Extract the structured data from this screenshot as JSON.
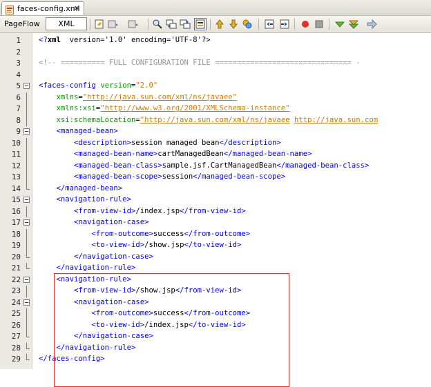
{
  "tab": {
    "title": "faces-config.xml",
    "close": "×",
    "icon": "xml-file-icon"
  },
  "toolbar": {
    "pageflow_label": "PageFlow",
    "xml_label": "XML",
    "icons": [
      "last-edit-icon",
      "back-icon",
      "forward-icon",
      "find-selection-icon",
      "find-previous-icon",
      "find-next-icon",
      "toggle-highlight-icon",
      "previous-bookmark-icon",
      "next-bookmark-icon",
      "toggle-bookmark-icon",
      "shift-left-icon",
      "shift-right-icon",
      "start-macro-icon",
      "stop-macro-icon",
      "check-xml-icon",
      "validate-xml-icon",
      "xsl-transform-icon"
    ]
  },
  "editor": {
    "lines": [
      {
        "n": "1",
        "parts": [
          [
            "t",
            "<?"
          ],
          [
            "b",
            "xml"
          ],
          [
            "",
            "  version='1.0' encoding='UTF-8'?>"
          ]
        ]
      },
      {
        "n": "2",
        "parts": []
      },
      {
        "n": "3",
        "parts": [
          [
            "c",
            "<!-- ========== FULL CONFIGURATION FILE =============================== -"
          ]
        ]
      },
      {
        "n": "4",
        "parts": []
      },
      {
        "n": "5",
        "fold": "open",
        "parts": [
          [
            "t",
            "<faces-config"
          ],
          [
            "",
            " "
          ],
          [
            "a",
            "version"
          ],
          [
            "",
            "="
          ],
          [
            "s",
            "\"2.0\""
          ]
        ]
      },
      {
        "n": "6",
        "fold": "line",
        "parts": [
          [
            "",
            "    "
          ],
          [
            "a",
            "xmlns"
          ],
          [
            "",
            "="
          ],
          [
            "v",
            "\"http://java.sun.com/xml/ns/javaee\""
          ]
        ]
      },
      {
        "n": "7",
        "fold": "line",
        "parts": [
          [
            "",
            "    "
          ],
          [
            "a",
            "xmlns:xsi"
          ],
          [
            "",
            "="
          ],
          [
            "v",
            "\"http://www.w3.org/2001/XMLSchema-instance\""
          ]
        ]
      },
      {
        "n": "8",
        "fold": "line",
        "parts": [
          [
            "",
            "    "
          ],
          [
            "a",
            "xsi:schemaLocation"
          ],
          [
            "",
            "="
          ],
          [
            "v",
            "\"http://java.sun.com/xml/ns/javaee"
          ],
          [
            "",
            " "
          ],
          [
            "v",
            "http://java.sun.com"
          ]
        ]
      },
      {
        "n": "9",
        "fold": "open",
        "parts": [
          [
            "",
            "    "
          ],
          [
            "t",
            "<managed-bean>"
          ]
        ]
      },
      {
        "n": "10",
        "fold": "line",
        "parts": [
          [
            "",
            "        "
          ],
          [
            "t",
            "<description>"
          ],
          [
            "",
            "session managed bean"
          ],
          [
            "t",
            "</description>"
          ]
        ]
      },
      {
        "n": "11",
        "fold": "line",
        "parts": [
          [
            "",
            "        "
          ],
          [
            "t",
            "<managed-bean-name>"
          ],
          [
            "",
            "cartManagedBean"
          ],
          [
            "t",
            "</managed-bean-name>"
          ]
        ]
      },
      {
        "n": "12",
        "fold": "line",
        "parts": [
          [
            "",
            "        "
          ],
          [
            "t",
            "<managed-bean-class>"
          ],
          [
            "",
            "sample.jsf.CartManagedBean"
          ],
          [
            "t",
            "</managed-bean-class>"
          ]
        ]
      },
      {
        "n": "13",
        "fold": "line",
        "parts": [
          [
            "",
            "        "
          ],
          [
            "t",
            "<managed-bean-scope>"
          ],
          [
            "",
            "session"
          ],
          [
            "t",
            "</managed-bean-scope>"
          ]
        ]
      },
      {
        "n": "14",
        "fold": "end",
        "parts": [
          [
            "",
            "    "
          ],
          [
            "t",
            "</managed-bean>"
          ]
        ]
      },
      {
        "n": "15",
        "fold": "open",
        "parts": [
          [
            "",
            "    "
          ],
          [
            "t",
            "<navigation-rule>"
          ]
        ]
      },
      {
        "n": "16",
        "fold": "line",
        "parts": [
          [
            "",
            "        "
          ],
          [
            "t",
            "<from-view-id>"
          ],
          [
            "",
            "/index.jsp"
          ],
          [
            "t",
            "</from-view-id>"
          ]
        ]
      },
      {
        "n": "17",
        "fold": "open",
        "parts": [
          [
            "",
            "        "
          ],
          [
            "t",
            "<navigation-case>"
          ]
        ]
      },
      {
        "n": "18",
        "fold": "line",
        "parts": [
          [
            "",
            "            "
          ],
          [
            "t",
            "<from-outcome>"
          ],
          [
            "",
            "success"
          ],
          [
            "t",
            "</from-outcome>"
          ]
        ]
      },
      {
        "n": "19",
        "fold": "line",
        "parts": [
          [
            "",
            "            "
          ],
          [
            "t",
            "<to-view-id>"
          ],
          [
            "",
            "/show.jsp"
          ],
          [
            "t",
            "</to-view-id>"
          ]
        ]
      },
      {
        "n": "20",
        "fold": "end",
        "parts": [
          [
            "",
            "        "
          ],
          [
            "t",
            "</navigation-case>"
          ]
        ]
      },
      {
        "n": "21",
        "fold": "end",
        "parts": [
          [
            "",
            "    "
          ],
          [
            "t",
            "</navigation-rule>"
          ]
        ]
      },
      {
        "n": "22",
        "fold": "open",
        "parts": [
          [
            "",
            "    "
          ],
          [
            "t",
            "<navigation-rule>"
          ]
        ]
      },
      {
        "n": "23",
        "fold": "line",
        "parts": [
          [
            "",
            "        "
          ],
          [
            "t",
            "<from-view-id>"
          ],
          [
            "",
            "/show.jsp"
          ],
          [
            "t",
            "</from-view-id>"
          ]
        ]
      },
      {
        "n": "24",
        "fold": "open",
        "parts": [
          [
            "",
            "        "
          ],
          [
            "t",
            "<navigation-case>"
          ]
        ]
      },
      {
        "n": "25",
        "fold": "line",
        "parts": [
          [
            "",
            "            "
          ],
          [
            "t",
            "<from-outcome>"
          ],
          [
            "",
            "success"
          ],
          [
            "t",
            "</from-outcome>"
          ]
        ]
      },
      {
        "n": "26",
        "fold": "line",
        "parts": [
          [
            "",
            "            "
          ],
          [
            "t",
            "<to-view-id>"
          ],
          [
            "",
            "/index.jsp"
          ],
          [
            "t",
            "</to-view-id>"
          ]
        ]
      },
      {
        "n": "27",
        "fold": "end",
        "parts": [
          [
            "",
            "        "
          ],
          [
            "t",
            "</navigation-case>"
          ]
        ]
      },
      {
        "n": "28",
        "fold": "end",
        "parts": [
          [
            "",
            "    "
          ],
          [
            "t",
            "</navigation-rule>"
          ]
        ]
      },
      {
        "n": "29",
        "fold": "end",
        "parts": [
          [
            "t",
            "</faces-config>"
          ]
        ]
      }
    ],
    "highlight_color": "#e0302a"
  }
}
